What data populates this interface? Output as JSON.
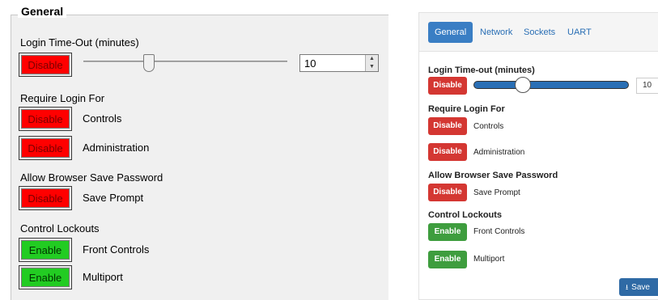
{
  "left": {
    "group_title": "General",
    "login_timeout_label": "Login Time-Out (minutes)",
    "login_timeout_button": "Disable",
    "login_timeout_value": "10",
    "require_login_label": "Require Login For",
    "require_items": [
      {
        "button": "Disable",
        "label": "Controls"
      },
      {
        "button": "Disable",
        "label": "Administration"
      }
    ],
    "save_password_label": "Allow Browser Save Password",
    "save_password_item": {
      "button": "Disable",
      "label": "Save Prompt"
    },
    "lockouts_label": "Control Lockouts",
    "lockout_items": [
      {
        "button": "Enable",
        "label": "Front Controls"
      },
      {
        "button": "Enable",
        "label": "Multiport"
      }
    ]
  },
  "right": {
    "tabs": [
      "General",
      "Network",
      "Sockets",
      "UART"
    ],
    "active_tab": "General",
    "login_timeout_label": "Login Time-out (minutes)",
    "login_timeout_button": "Disable",
    "login_timeout_value": "10",
    "require_login_label": "Require Login For",
    "require_items": [
      {
        "button": "Disable",
        "label": "Controls"
      },
      {
        "button": "Disable",
        "label": "Administration"
      }
    ],
    "save_password_label": "Allow Browser Save Password",
    "save_password_item": {
      "button": "Disable",
      "label": "Save Prompt"
    },
    "lockouts_label": "Control Lockouts",
    "lockout_items": [
      {
        "button": "Enable",
        "label": "Front Controls"
      },
      {
        "button": "Enable",
        "label": "Multiport"
      }
    ],
    "save_button": "Save"
  },
  "colors": {
    "disable_red_left": "#ff0000",
    "enable_green_left": "#22cc22",
    "disable_red_right": "#d43732",
    "enable_green_right": "#3e9d3e",
    "accent_blue": "#3a7ec4"
  },
  "icons": {
    "save": "upload-icon"
  }
}
